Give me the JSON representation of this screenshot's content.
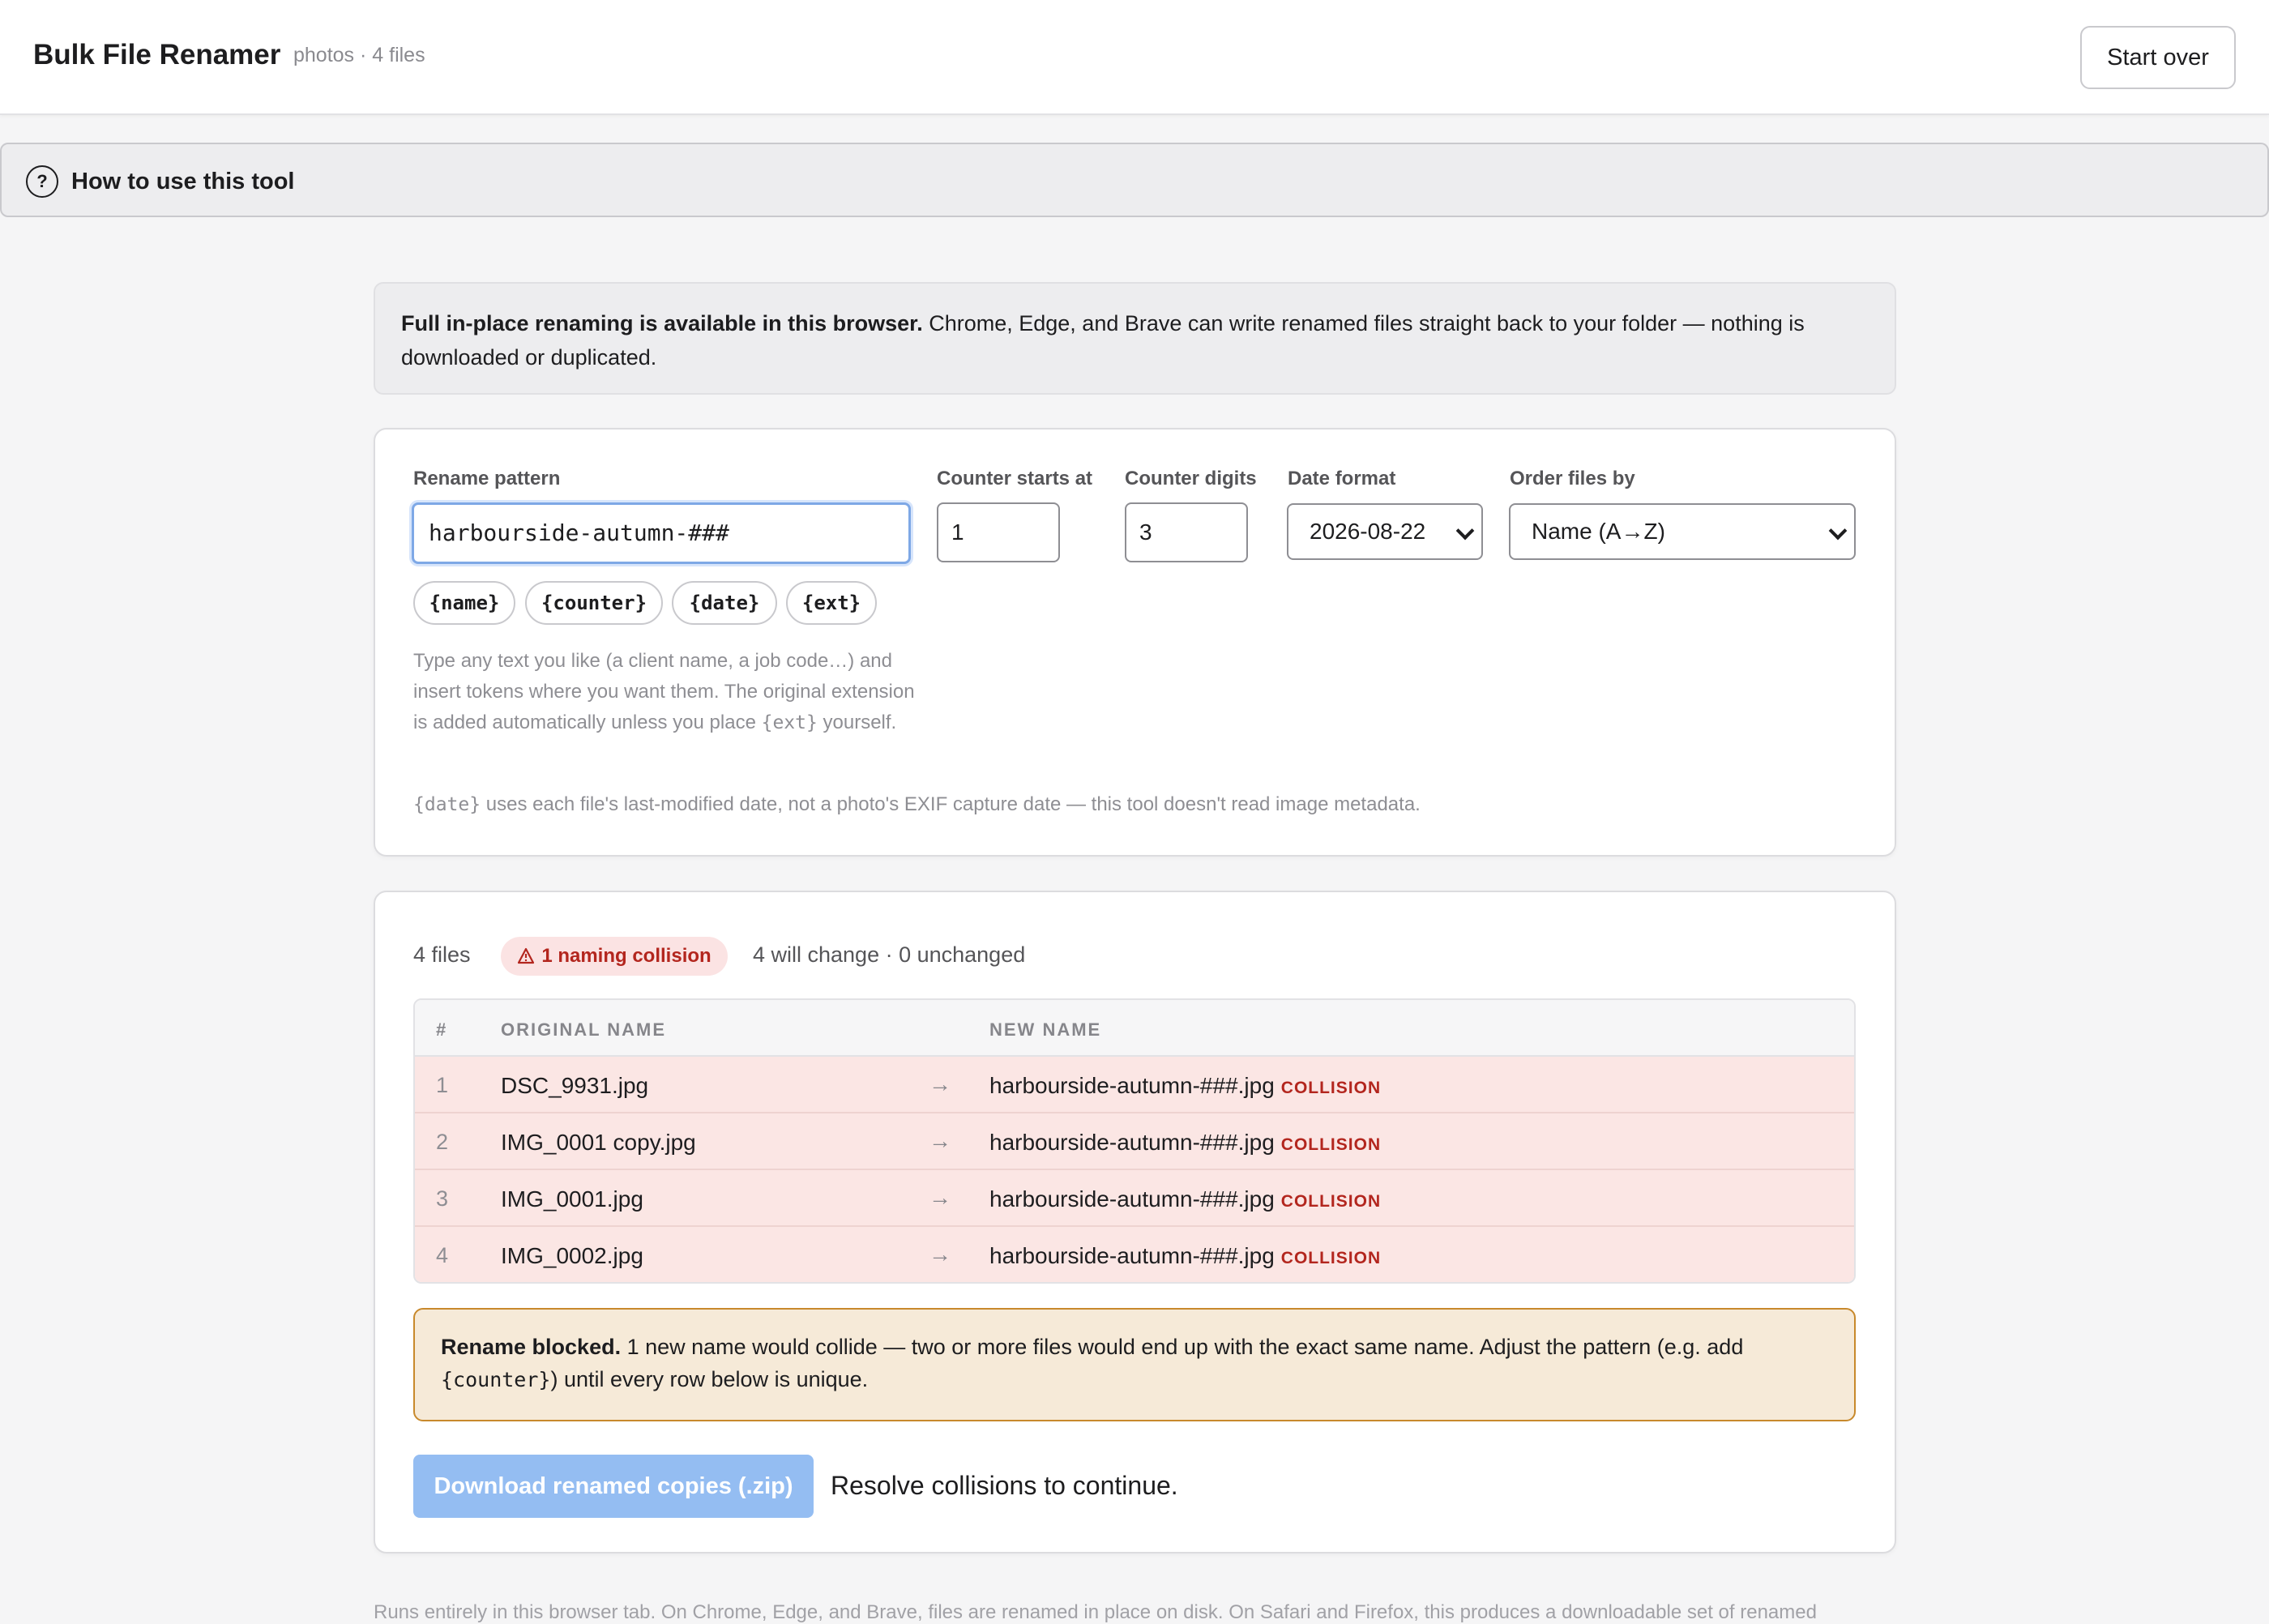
{
  "header": {
    "title": "Bulk File Renamer",
    "subtitle": "photos · 4 files",
    "start_over": "Start over"
  },
  "howto": {
    "label": "How to use this tool",
    "icon": "question-circle-icon"
  },
  "notice": {
    "bold": "Full in-place renaming is available in this browser.",
    "text": " Chrome, Edge, and Brave can write renamed files straight back to your folder — nothing is downloaded or duplicated."
  },
  "settings": {
    "pattern_label": "Rename pattern",
    "pattern_value": "harbourside-autumn-###",
    "counter_start_label": "Counter starts at",
    "counter_start_value": "1",
    "counter_digits_label": "Counter digits",
    "counter_digits_value": "3",
    "date_format_label": "Date format",
    "date_format_value": "2026-08-22",
    "order_label": "Order files by",
    "order_value": "Name (A→Z)",
    "tokens": [
      "{name}",
      "{counter}",
      "{date}",
      "{ext}"
    ],
    "help_text_1": "Type any text you like (a client name, a job code…) and insert tokens where you want them. The original extension is added automatically unless you place ",
    "help_token": "{ext}",
    "help_text_2": " yourself.",
    "note_token": "{date}",
    "note_text": " uses each file's last-modified date, not a photo's EXIF capture date — this tool doesn't read image metadata."
  },
  "preview": {
    "file_count": "4 files",
    "collision_badge": "1 naming collision",
    "change_summary": "4 will change · 0 unchanged",
    "columns": {
      "num": "#",
      "original": "ORIGINAL NAME",
      "new": "NEW NAME"
    },
    "rows": [
      {
        "num": "1",
        "original": "DSC_9931.jpg",
        "new": "harbourside-autumn-###.jpg",
        "tag": "COLLISION"
      },
      {
        "num": "2",
        "original": "IMG_0001 copy.jpg",
        "new": "harbourside-autumn-###.jpg",
        "tag": "COLLISION"
      },
      {
        "num": "3",
        "original": "IMG_0001.jpg",
        "new": "harbourside-autumn-###.jpg",
        "tag": "COLLISION"
      },
      {
        "num": "4",
        "original": "IMG_0002.jpg",
        "new": "harbourside-autumn-###.jpg",
        "tag": "COLLISION"
      }
    ],
    "blocked_bold": "Rename blocked.",
    "blocked_text_1": " 1 new name would collide — two or more files would end up with the exact same name. Adjust the pattern (e.g. add ",
    "blocked_token": "{counter}",
    "blocked_text_2": ") until every row below is unique.",
    "download_label": "Download renamed copies (.zip)",
    "resolve_text": "Resolve collisions to continue."
  },
  "footer": {
    "text": "Runs entirely in this browser tab. On Chrome, Edge, and Brave, files are renamed in place on disk. On Safari and Firefox, this produces a downloadable set of renamed"
  },
  "colors": {
    "accent": "#94bdf2",
    "collision": "#b3261e",
    "row_collision_bg": "#fbe6e4",
    "blocked_bg": "#f6ead8",
    "blocked_border": "#c8892c"
  }
}
